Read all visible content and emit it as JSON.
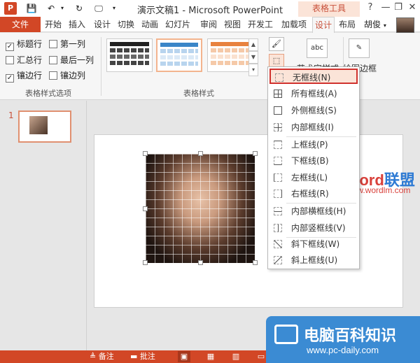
{
  "titlebar": {
    "title": "演示文稿1 - Microsoft PowerPoint",
    "app_icon": "P",
    "table_tools": "表格工具",
    "help": "?",
    "minimize": "—",
    "restore": "❐",
    "close": "✕"
  },
  "tabs": {
    "file": "文件",
    "items": [
      "开始",
      "插入",
      "设计",
      "切换",
      "动画",
      "幻灯片",
      "审阅",
      "视图",
      "开发工",
      "加载项",
      "设计",
      "布局"
    ],
    "active": "设计",
    "user": "胡俊"
  },
  "ribbon": {
    "options": [
      {
        "label": "标题行",
        "checked": true
      },
      {
        "label": "第一列",
        "checked": false
      },
      {
        "label": "汇总行",
        "checked": false
      },
      {
        "label": "最后一列",
        "checked": false
      },
      {
        "label": "镶边行",
        "checked": true
      },
      {
        "label": "镶边列",
        "checked": false
      }
    ],
    "options_group": "表格样式选项",
    "styles_group": "表格样式",
    "art_text": "艺术字样式",
    "draw_border": "绘图边框",
    "art_icon_text": "abc"
  },
  "left": {
    "slide_number": "1"
  },
  "menu": {
    "items": [
      {
        "label": "无框线(N)",
        "selected": true
      },
      {
        "label": "所有框线(A)",
        "selected": false
      },
      {
        "label": "外侧框线(S)",
        "selected": false
      },
      {
        "label": "内部框线(I)",
        "selected": false
      },
      {
        "label": "上框线(P)",
        "selected": false
      },
      {
        "label": "下框线(B)",
        "selected": false
      },
      {
        "label": "左框线(L)",
        "selected": false
      },
      {
        "label": "右框线(R)",
        "selected": false
      },
      {
        "label": "内部横框线(H)",
        "selected": false
      },
      {
        "label": "内部竖框线(V)",
        "selected": false
      },
      {
        "label": "斜下框线(W)",
        "selected": false
      },
      {
        "label": "斜上框线(U)",
        "selected": false
      }
    ]
  },
  "watermark": {
    "word_a": "Word",
    "word_b": "联盟",
    "url": "www.wordlm.com"
  },
  "status": {
    "notes": "备注",
    "comments": "批注"
  },
  "brand": {
    "name": "电脑百科知识",
    "url": "www.pc-daily.com"
  },
  "colors": {
    "accent": "#d24726",
    "highlight_border": "#d0312d",
    "brand_blue": "#3b8bd3"
  }
}
